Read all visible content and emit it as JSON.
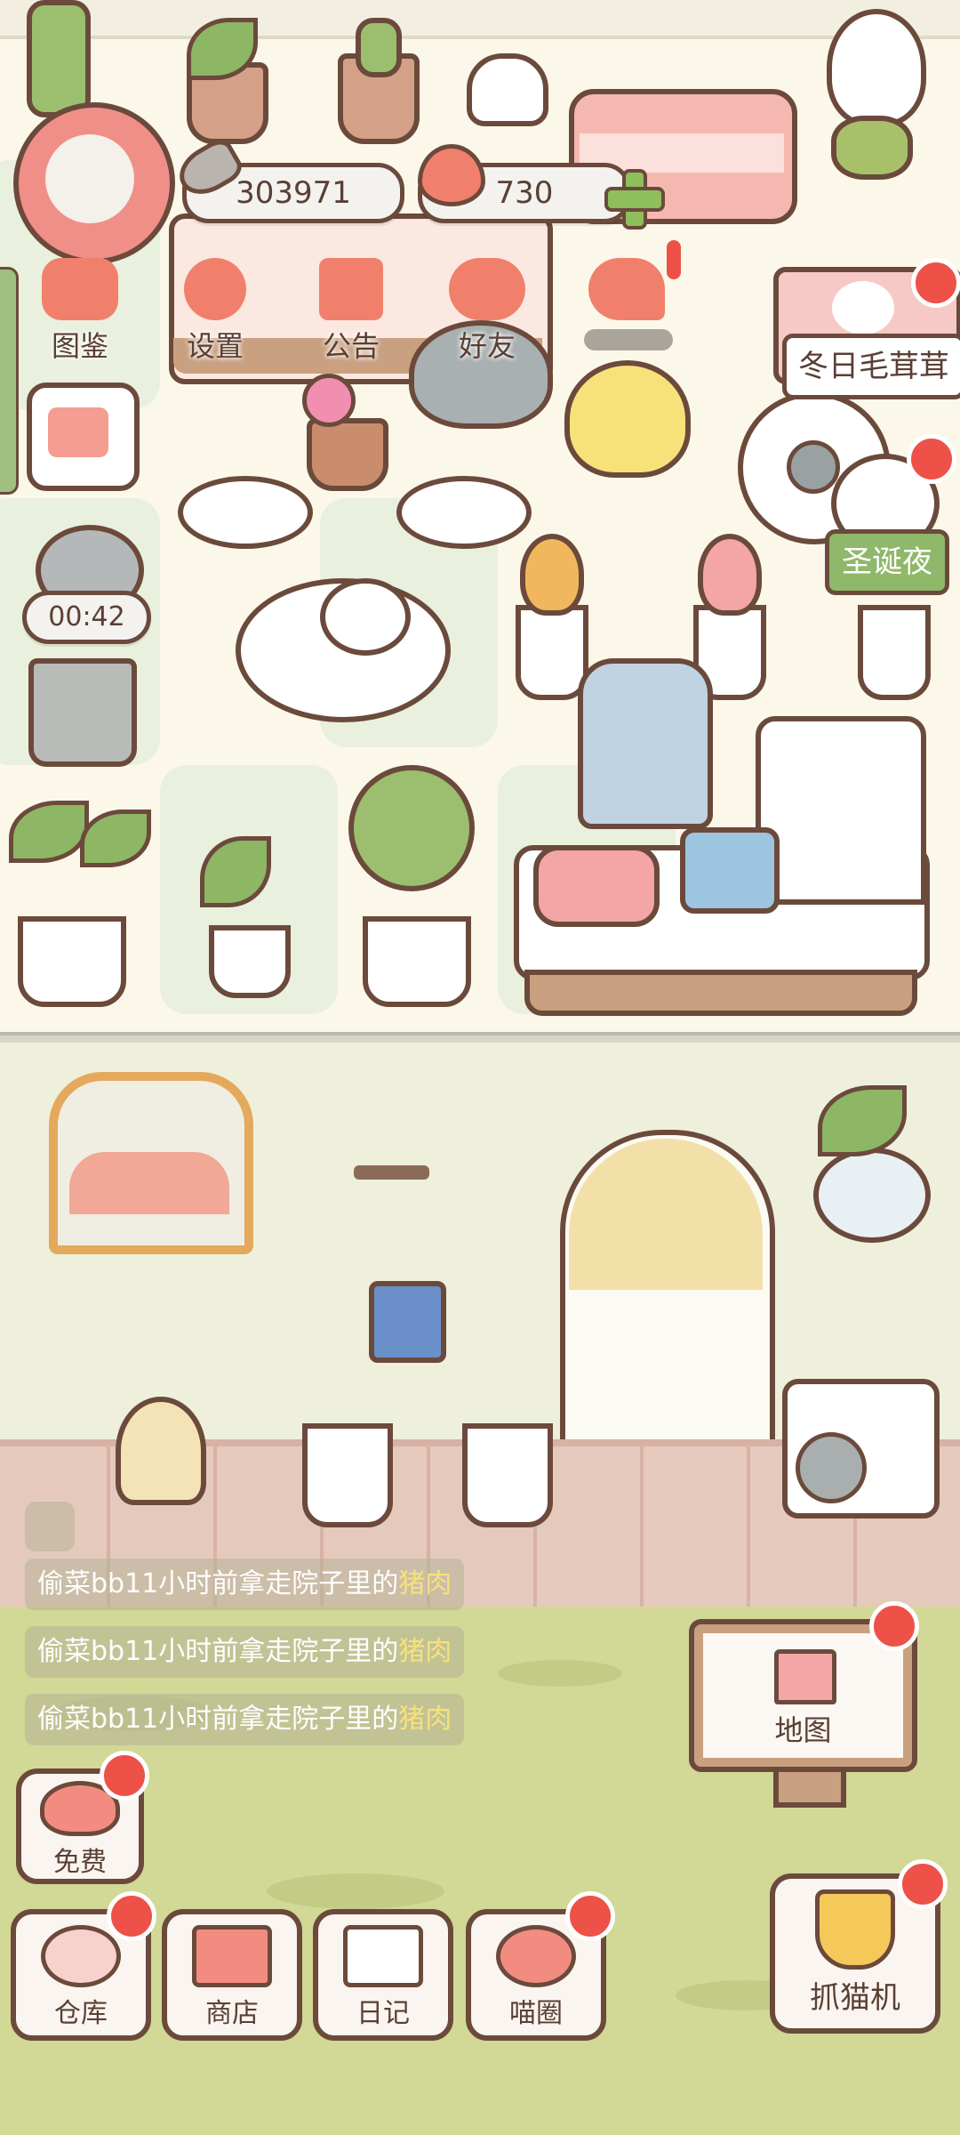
{
  "hud": {
    "coins": "303971",
    "hearts": "730",
    "timer": "00:42"
  },
  "menu": {
    "items": [
      {
        "label": "图鉴",
        "icon": "cat-book-icon"
      },
      {
        "label": "设置",
        "icon": "gear-icon"
      },
      {
        "label": "公告",
        "icon": "gift-icon"
      },
      {
        "label": "好友",
        "icon": "friends-icon"
      },
      {
        "label": "",
        "icon": "chat-icon"
      }
    ]
  },
  "events": {
    "winter": "冬日毛茸茸",
    "christmas": "圣诞夜"
  },
  "notices": [
    {
      "prefix": "偷菜bb11小时前拿走院子里的",
      "item": "猪肉"
    },
    {
      "prefix": "偷菜bb11小时前拿走院子里的",
      "item": "猪肉"
    },
    {
      "prefix": "偷菜bb11小时前拿走院子里的",
      "item": "猪肉"
    }
  ],
  "buttons": {
    "map": "地图",
    "free": "免费",
    "warehouse": "仓库",
    "shop": "商店",
    "diary": "日记",
    "cat_circle": "喵圈",
    "claw_machine": "抓猫机"
  },
  "colors": {
    "badge": "#ee5147",
    "highlight": "#f7e27a",
    "outline": "#6b4a3c",
    "accent_pink": "#f0806c",
    "yard": "#d2d895"
  }
}
